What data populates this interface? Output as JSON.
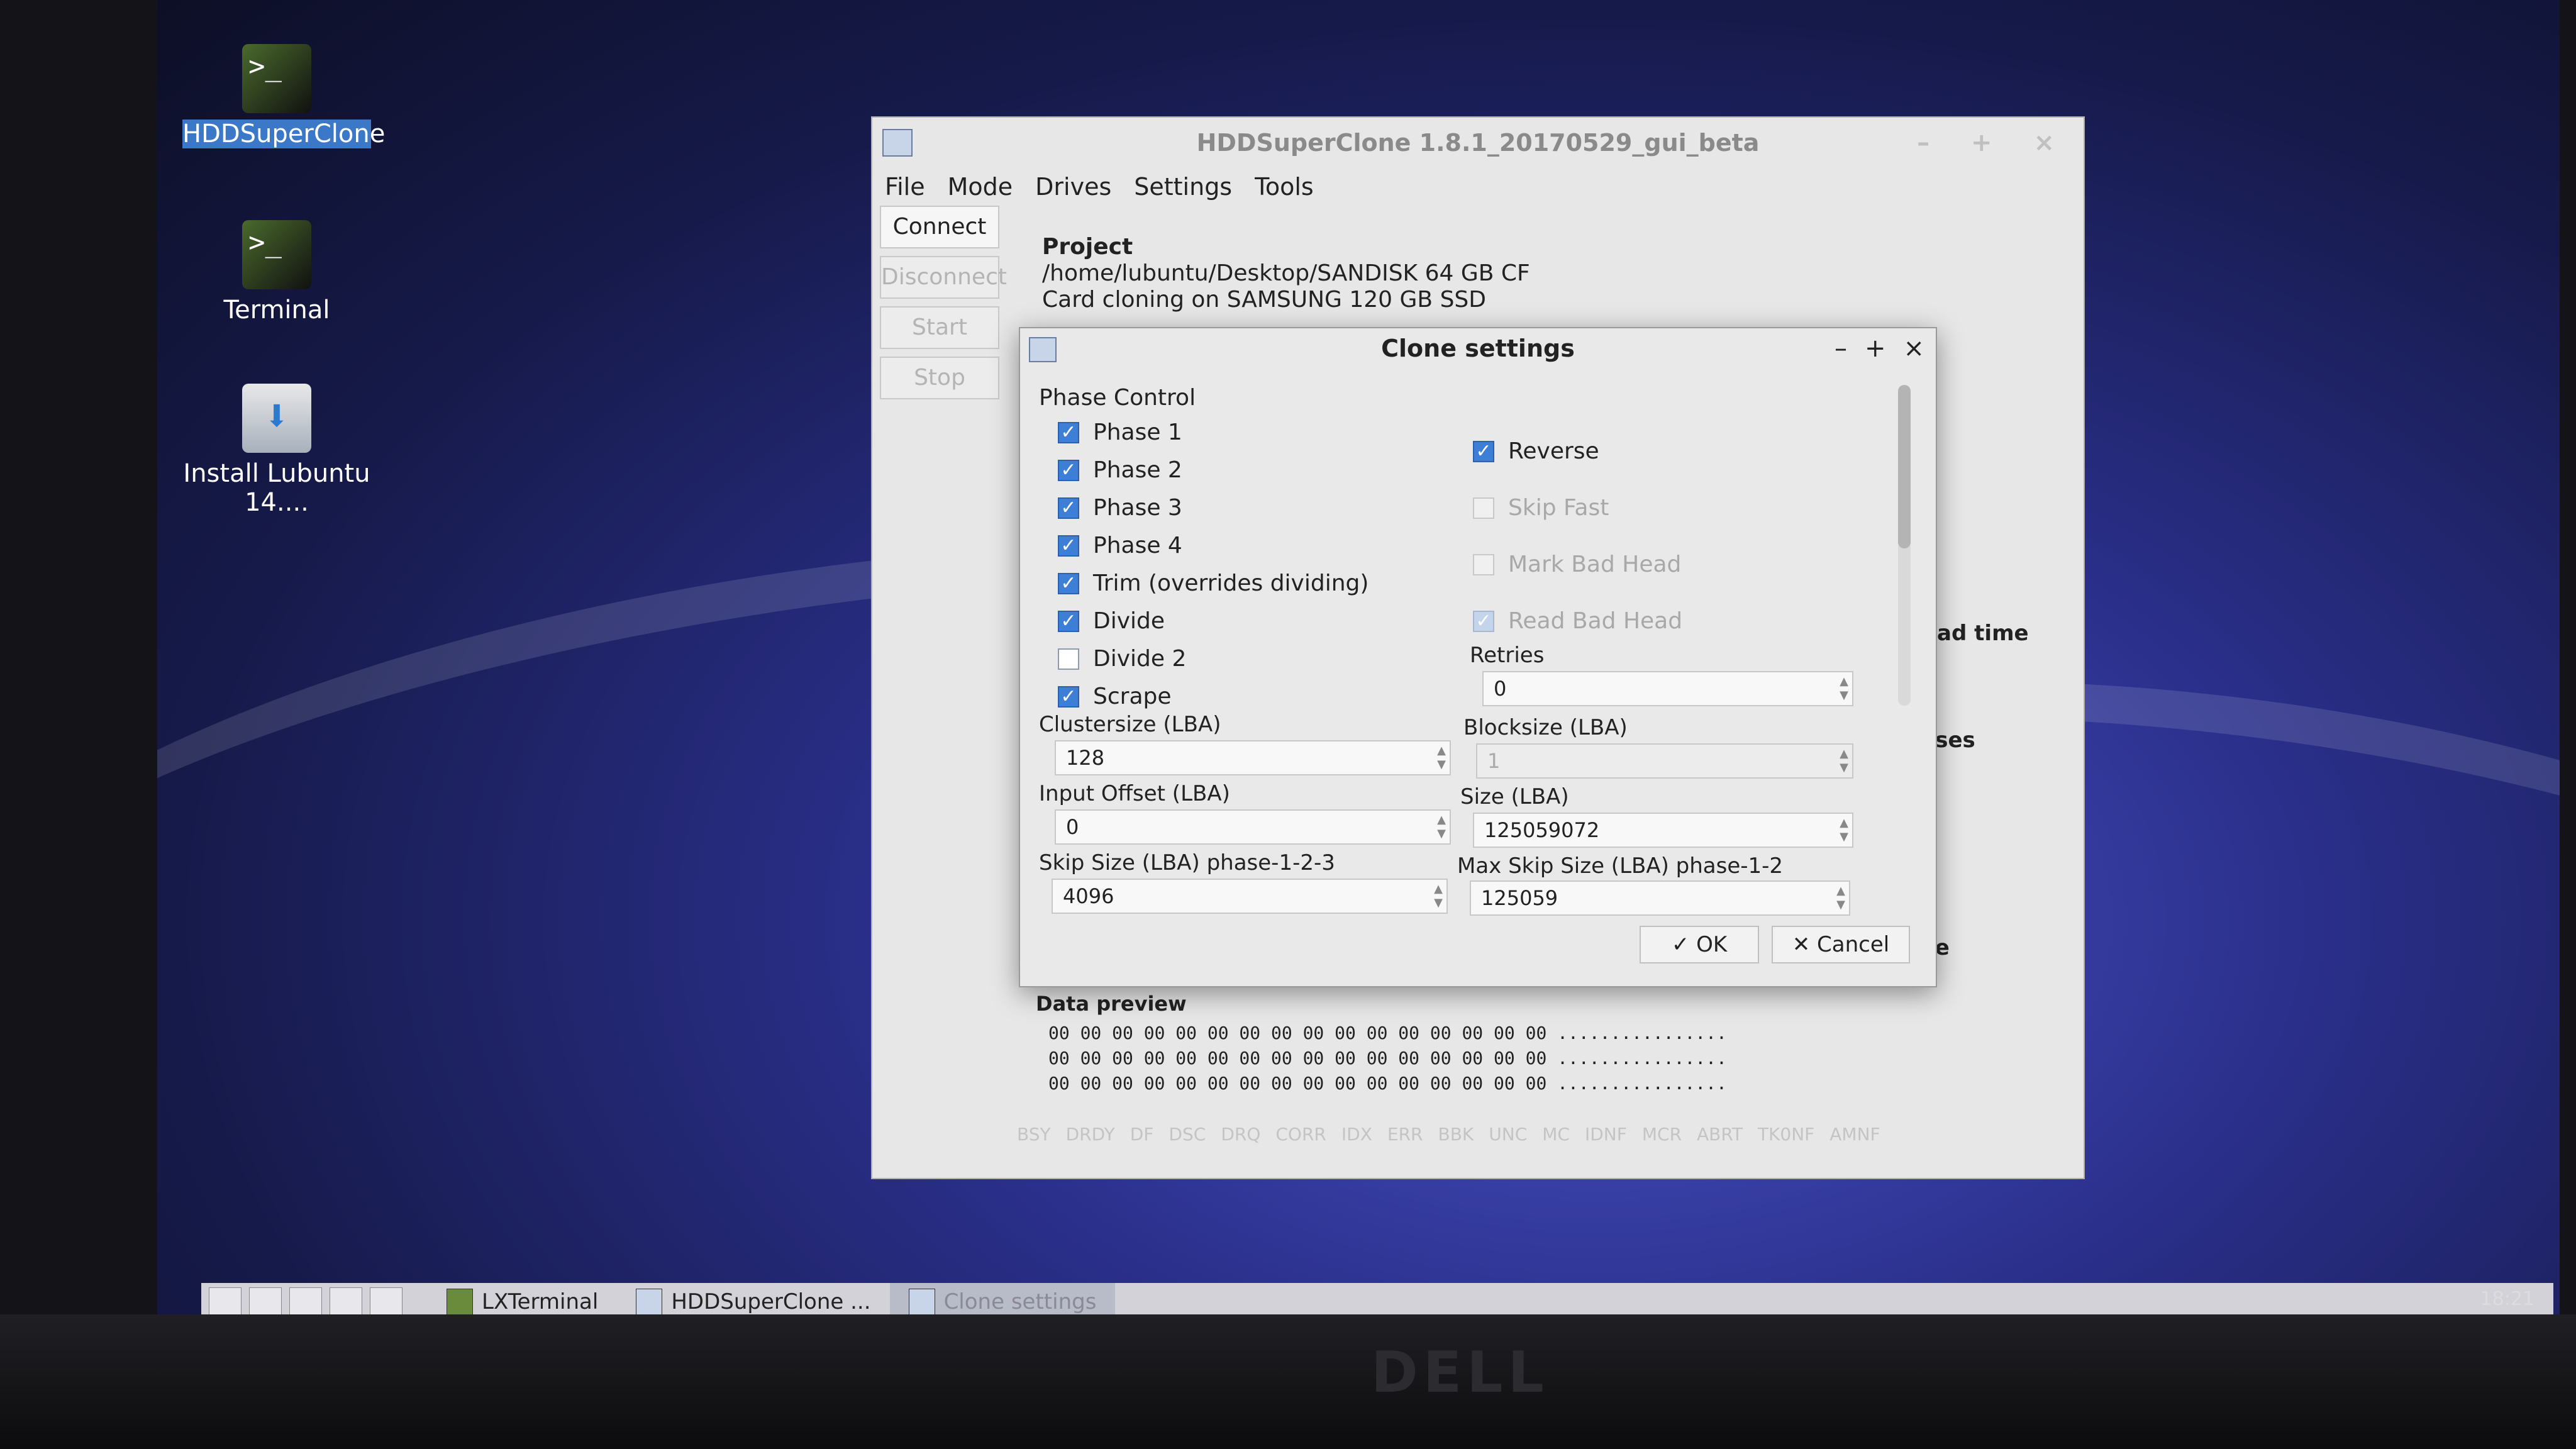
{
  "desktop": {
    "icons": [
      {
        "label": "HDDSuperClone",
        "glyph": ">_"
      },
      {
        "label": "Terminal",
        "glyph": ">_"
      },
      {
        "label": "Install Lubuntu 14....",
        "glyph": "⬇"
      }
    ]
  },
  "main_window": {
    "title": "HDDSuperClone 1.8.1_20170529_gui_beta",
    "controls": "– + ×",
    "menu": [
      "File",
      "Mode",
      "Drives",
      "Settings",
      "Tools"
    ],
    "side_buttons": [
      "Connect",
      "Disconnect",
      "Start",
      "Stop"
    ],
    "project": {
      "heading": "Project",
      "path": "/home/lubuntu/Desktop/SANDISK 64 GB CF",
      "description": "Card cloning on SAMSUNG 120 GB SSD"
    },
    "partial_labels": {
      "read_time": "ead time",
      "passes": "sses",
      "size": "ze"
    },
    "data_preview": {
      "heading": "Data preview",
      "rows": [
        "00 00 00 00 00 00 00 00 00 00 00 00 00 00 00 00 ................",
        "00 00 00 00 00 00 00 00 00 00 00 00 00 00 00 00 ................",
        "00 00 00 00 00 00 00 00 00 00 00 00 00 00 00 00 ................"
      ]
    },
    "status_flags": [
      "BSY",
      "DRDY",
      "DF",
      "DSC",
      "DRQ",
      "CORR",
      "IDX",
      "ERR",
      "BBK",
      "UNC",
      "MC",
      "IDNF",
      "MCR",
      "ABRT",
      "TK0NF",
      "AMNF"
    ]
  },
  "dialog": {
    "title": "Clone settings",
    "controls": {
      "minimize": "–",
      "maximize": "+",
      "close": "×"
    },
    "group_label": "Phase Control",
    "left_checks": [
      {
        "label": "Phase 1",
        "checked": true
      },
      {
        "label": "Phase 2",
        "checked": true
      },
      {
        "label": "Phase 3",
        "checked": true
      },
      {
        "label": "Phase 4",
        "checked": true
      },
      {
        "label": "Trim (overrides dividing)",
        "checked": true
      },
      {
        "label": "Divide",
        "checked": true
      },
      {
        "label": "Divide 2",
        "checked": false
      },
      {
        "label": "Scrape",
        "checked": true
      }
    ],
    "right_checks": [
      {
        "label": "Reverse",
        "checked": true,
        "enabled": true
      },
      {
        "label": "Skip Fast",
        "checked": false,
        "enabled": false
      },
      {
        "label": "Mark Bad Head",
        "checked": false,
        "enabled": false
      },
      {
        "label": "Read Bad Head",
        "checked": true,
        "enabled": false
      }
    ],
    "fields": {
      "retries": {
        "label": "Retries",
        "value": "0"
      },
      "clustersize": {
        "label": "Clustersize (LBA)",
        "value": "128"
      },
      "blocksize": {
        "label": "Blocksize (LBA)",
        "value": "1"
      },
      "input_offset": {
        "label": "Input Offset (LBA)",
        "value": "0"
      },
      "size": {
        "label": "Size (LBA)",
        "value": "125059072"
      },
      "skip_size": {
        "label": "Skip Size (LBA) phase-1-2-3",
        "value": "4096"
      },
      "max_skip_size": {
        "label": "Max Skip Size (LBA) phase-1-2",
        "value": "125059"
      }
    },
    "buttons": {
      "ok": "✓ OK",
      "cancel": "✕ Cancel"
    }
  },
  "taskbar": {
    "items": [
      "LXTerminal",
      "HDDSuperClone ...",
      "Clone settings"
    ],
    "clock": "18:21"
  }
}
